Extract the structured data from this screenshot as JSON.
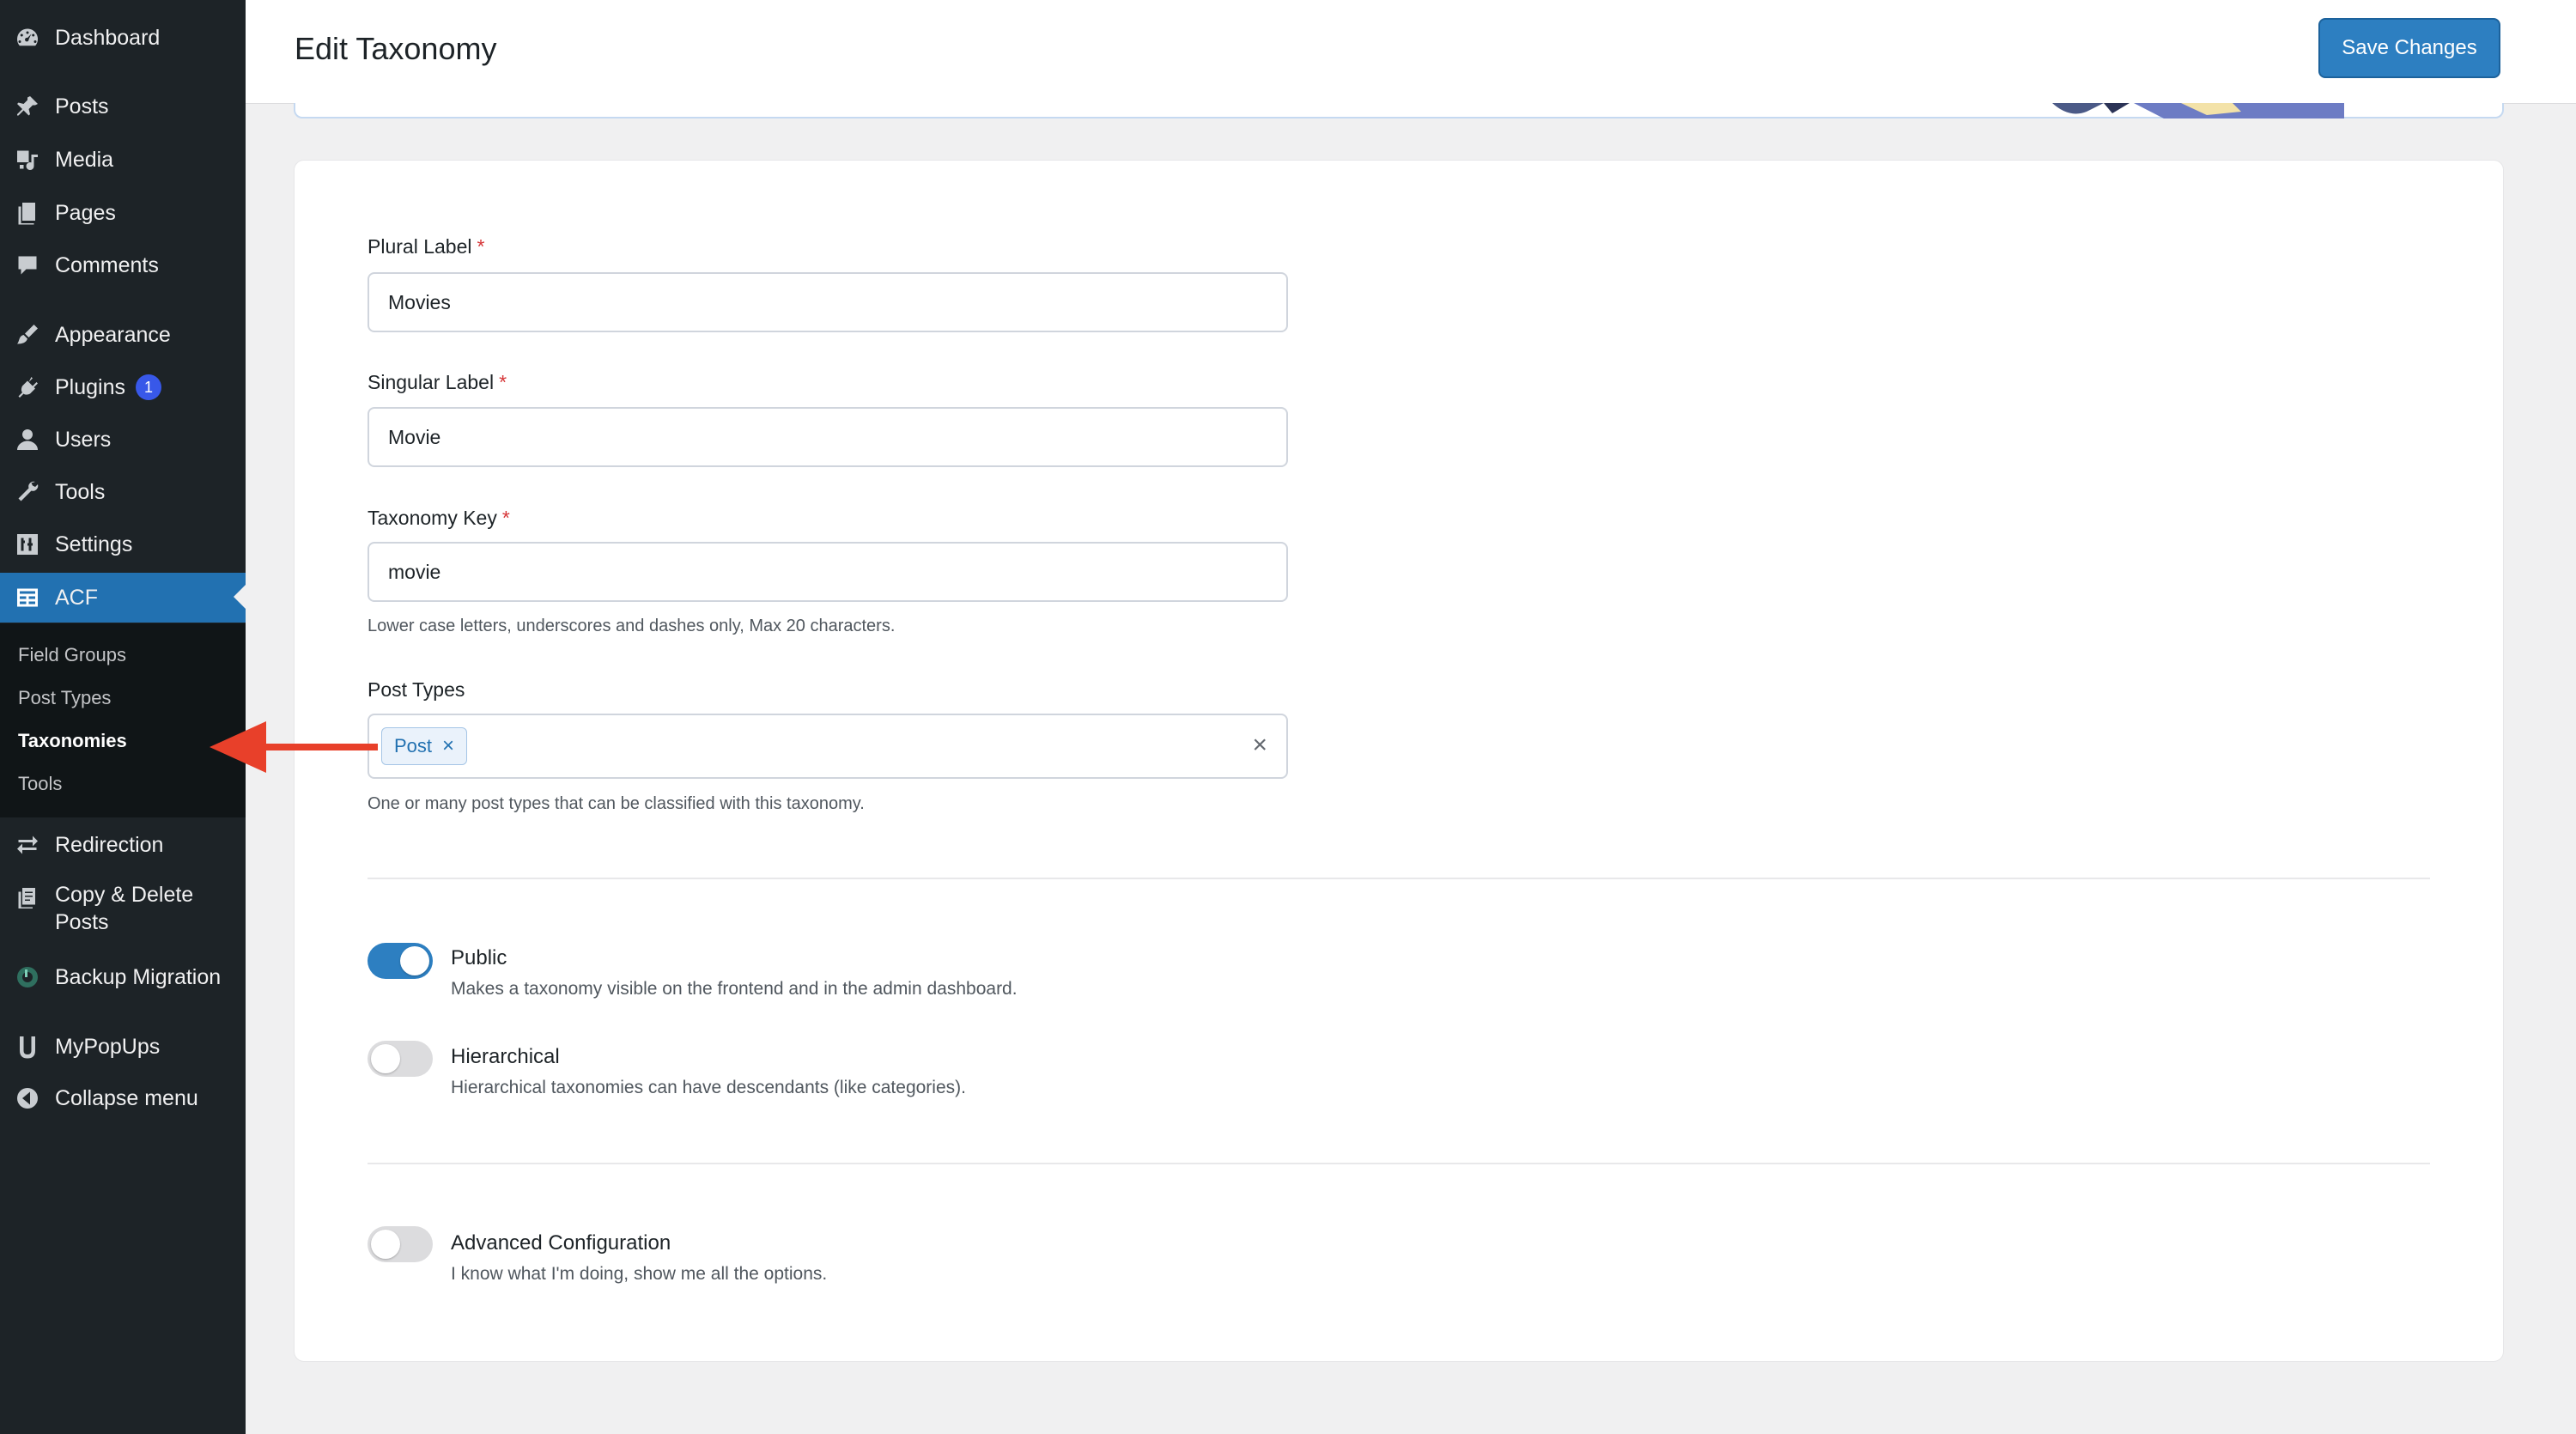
{
  "sidebar": {
    "items": [
      {
        "label": "Dashboard",
        "icon": "dashboard-icon"
      },
      {
        "label": "Posts",
        "icon": "pin-icon"
      },
      {
        "label": "Media",
        "icon": "media-icon"
      },
      {
        "label": "Pages",
        "icon": "pages-icon"
      },
      {
        "label": "Comments",
        "icon": "comment-icon"
      },
      {
        "label": "Appearance",
        "icon": "brush-icon"
      },
      {
        "label": "Plugins",
        "icon": "plugin-icon",
        "badge": "1"
      },
      {
        "label": "Users",
        "icon": "user-icon"
      },
      {
        "label": "Tools",
        "icon": "wrench-icon"
      },
      {
        "label": "Settings",
        "icon": "settings-icon"
      },
      {
        "label": "ACF",
        "icon": "acf-icon"
      },
      {
        "label": "Redirection",
        "icon": "redirect-icon"
      },
      {
        "label": "Copy & Delete",
        "label2": "Posts",
        "icon": "copy-icon"
      },
      {
        "label": "Backup Migration",
        "icon": "backup-icon"
      },
      {
        "label": "MyPopUps",
        "icon": "popups-icon"
      },
      {
        "label": "Collapse menu",
        "icon": "collapse-icon"
      }
    ],
    "acf_submenu": [
      "Field Groups",
      "Post Types",
      "Taxonomies",
      "Tools"
    ],
    "current_submenu": "Taxonomies"
  },
  "header": {
    "title": "Edit Taxonomy",
    "save_label": "Save Changes"
  },
  "form": {
    "plural_label": {
      "label": "Plural Label",
      "required": "*",
      "value": "Movies"
    },
    "singular_label": {
      "label": "Singular Label",
      "required": "*",
      "value": "Movie"
    },
    "taxonomy_key": {
      "label": "Taxonomy Key",
      "required": "*",
      "value": "movie",
      "help": "Lower case letters, underscores and dashes only, Max 20 characters."
    },
    "post_types": {
      "label": "Post Types",
      "chips": [
        "Post"
      ],
      "clear": "×",
      "help": "One or many post types that can be classified with this taxonomy."
    },
    "toggles": [
      {
        "title": "Public",
        "desc": "Makes a taxonomy visible on the frontend and in the admin dashboard.",
        "on": true
      },
      {
        "title": "Hierarchical",
        "desc": "Hierarchical taxonomies can have descendants (like categories).",
        "on": false
      },
      {
        "title": "Advanced Configuration",
        "desc": "I know what I'm doing, show me all the options.",
        "on": false
      }
    ]
  },
  "colors": {
    "sidebar_bg": "#1d2327",
    "accent": "#2271b1",
    "button": "#2d7fc1",
    "arrow": "#e8402a"
  }
}
